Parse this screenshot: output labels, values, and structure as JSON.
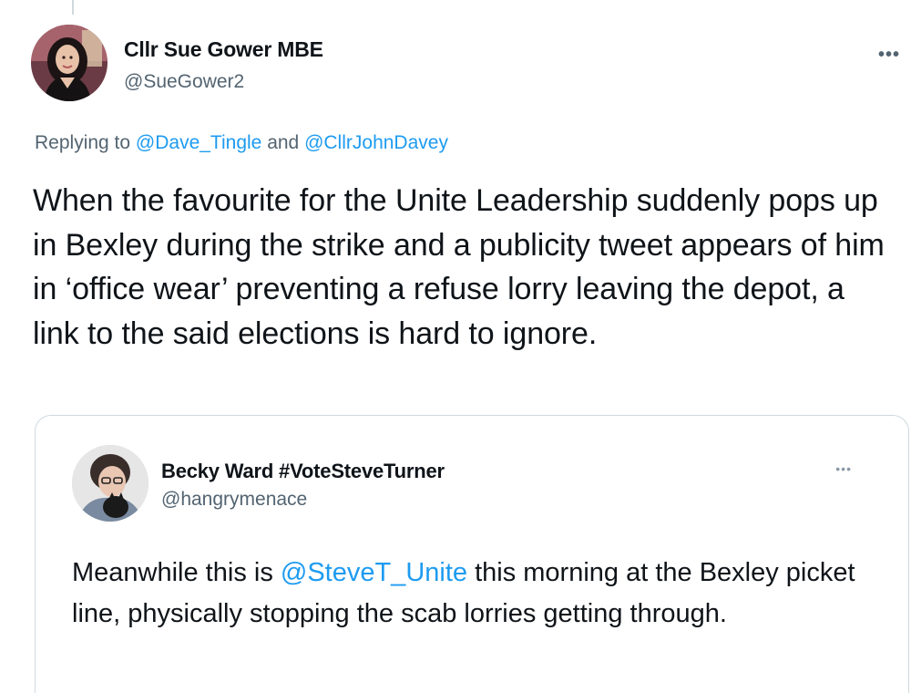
{
  "tweet": {
    "author_name": "Cllr Sue Gower MBE",
    "author_handle": "@SueGower2",
    "more_icon": "more-options-icon",
    "reply_prefix": "Replying to ",
    "reply_mention_1": "@Dave_Tingle",
    "reply_and": " and ",
    "reply_mention_2": "@CllrJohnDavey",
    "text": "When the favourite for the Unite Leadership suddenly pops up in Bexley during the strike and a publicity tweet appears of him in ‘office wear’ preventing a refuse lorry leaving the depot, a link to the said elections is hard to ignore."
  },
  "quoted_tweet": {
    "author_name": "Becky Ward #VoteSteveTurner",
    "author_handle": "@hangrymenace",
    "text_before": "Meanwhile this is ",
    "text_mention": "@SteveT_Unite",
    "text_after": " this morning at the Bexley picket line, physically stopping the scab lorries getting through."
  },
  "colors": {
    "link": "#1d9bf0",
    "secondary_text": "#536471",
    "border": "#cfd9de"
  }
}
